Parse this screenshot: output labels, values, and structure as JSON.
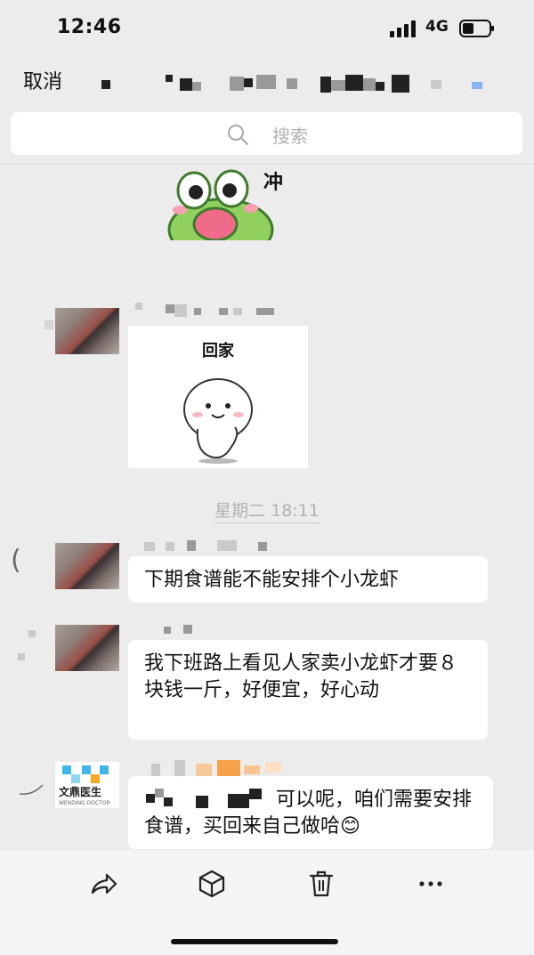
{
  "status_bar": {
    "time": "12:46",
    "network": "4G"
  },
  "header": {
    "cancel_label": "取消"
  },
  "search": {
    "placeholder": "搜索"
  },
  "sticker_frog": {
    "text": "冲"
  },
  "sticker_card": {
    "caption": "回家"
  },
  "timestamp": "星期二 18:11",
  "messages": [
    {
      "text": "下期食谱能不能安排个小龙虾"
    },
    {
      "text": "我下班路上看见人家卖小龙虾才要８块钱一斤，好便宜，好心动"
    },
    {
      "text": "可以呢，咱们需要安排食谱，买回来自己做哈",
      "emoji": "😊"
    }
  ],
  "logo_avatar": {
    "brand_text": "文鼎医生",
    "brand_sub": "WENDING DOCTOR"
  },
  "toolbar": {
    "icons": [
      "share-icon",
      "box-icon",
      "trash-icon",
      "more-icon"
    ]
  },
  "colors": {
    "background": "#ececec",
    "bubble": "#ffffff",
    "toolbar": "#f4f4f4",
    "logo_blue": "#3fb6e8",
    "logo_orange": "#f5a623"
  }
}
